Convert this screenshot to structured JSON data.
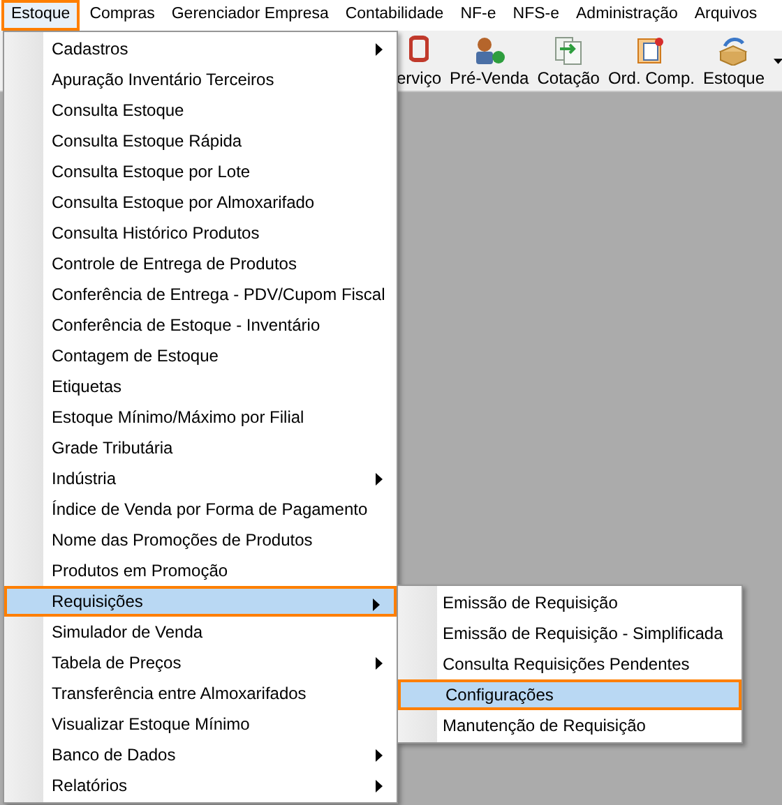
{
  "menubar": [
    {
      "label": "Estoque",
      "selected": true
    },
    {
      "label": "Compras",
      "selected": false
    },
    {
      "label": "Gerenciador Empresa",
      "selected": false
    },
    {
      "label": "Contabilidade",
      "selected": false
    },
    {
      "label": "NF-e",
      "selected": false
    },
    {
      "label": "NFS-e",
      "selected": false
    },
    {
      "label": "Administração",
      "selected": false
    },
    {
      "label": "Arquivos",
      "selected": false
    }
  ],
  "toolbar": [
    {
      "label": "erviço",
      "kind": "service"
    },
    {
      "label": "Pré-Venda",
      "kind": "presale"
    },
    {
      "label": "Cotação",
      "kind": "quote"
    },
    {
      "label": "Ord. Comp.",
      "kind": "order"
    },
    {
      "label": "Estoque",
      "kind": "stock"
    }
  ],
  "menu": [
    {
      "label": "Cadastros",
      "submenu": true,
      "selected": false
    },
    {
      "label": "Apuração Inventário Terceiros",
      "submenu": false,
      "selected": false
    },
    {
      "label": "Consulta Estoque",
      "submenu": false,
      "selected": false
    },
    {
      "label": "Consulta Estoque Rápida",
      "submenu": false,
      "selected": false
    },
    {
      "label": "Consulta Estoque por Lote",
      "submenu": false,
      "selected": false
    },
    {
      "label": "Consulta Estoque por Almoxarifado",
      "submenu": false,
      "selected": false
    },
    {
      "label": "Consulta Histórico Produtos",
      "submenu": false,
      "selected": false
    },
    {
      "label": "Controle de Entrega de Produtos",
      "submenu": false,
      "selected": false
    },
    {
      "label": "Conferência de Entrega - PDV/Cupom Fiscal",
      "submenu": false,
      "selected": false
    },
    {
      "label": "Conferência de Estoque - Inventário",
      "submenu": false,
      "selected": false
    },
    {
      "label": "Contagem de Estoque",
      "submenu": false,
      "selected": false
    },
    {
      "label": "Etiquetas",
      "submenu": false,
      "selected": false
    },
    {
      "label": "Estoque Mínimo/Máximo por Filial",
      "submenu": false,
      "selected": false
    },
    {
      "label": "Grade Tributária",
      "submenu": false,
      "selected": false
    },
    {
      "label": "Indústria",
      "submenu": true,
      "selected": false
    },
    {
      "label": "Índice de Venda por Forma de Pagamento",
      "submenu": false,
      "selected": false
    },
    {
      "label": "Nome das Promoções de Produtos",
      "submenu": false,
      "selected": false
    },
    {
      "label": "Produtos em Promoção",
      "submenu": false,
      "selected": false
    },
    {
      "label": "Requisições",
      "submenu": true,
      "selected": true,
      "children": [
        {
          "label": "Emissão de Requisição",
          "selected": false
        },
        {
          "label": "Emissão de Requisição - Simplificada",
          "selected": false
        },
        {
          "label": "Consulta Requisições Pendentes",
          "selected": false
        },
        {
          "label": "Configurações",
          "selected": true
        },
        {
          "label": "Manutenção de Requisição",
          "selected": false
        }
      ]
    },
    {
      "label": "Simulador de Venda",
      "submenu": false,
      "selected": false
    },
    {
      "label": "Tabela de Preços",
      "submenu": true,
      "selected": false
    },
    {
      "label": "Transferência entre Almoxarifados",
      "submenu": false,
      "selected": false
    },
    {
      "label": "Visualizar Estoque Mínimo",
      "submenu": false,
      "selected": false
    },
    {
      "label": "Banco de Dados",
      "submenu": true,
      "selected": false
    },
    {
      "label": "Relatórios",
      "submenu": true,
      "selected": false
    }
  ]
}
